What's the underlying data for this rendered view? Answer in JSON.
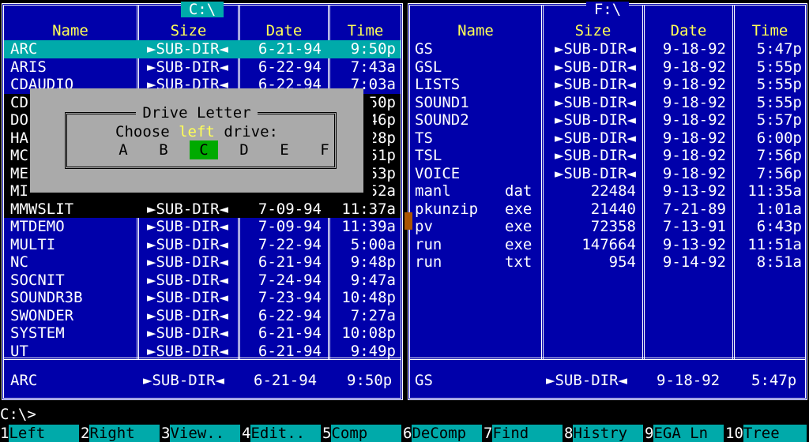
{
  "left_panel": {
    "title": "C:\\",
    "headers": [
      "Name",
      "Size",
      "Date",
      "Time"
    ],
    "rows": [
      {
        "name": "ARC",
        "ext": "",
        "size": "►SUB-DIR◄",
        "date": "6-21-94",
        "time": "9:50p"
      },
      {
        "name": "ARIS",
        "ext": "",
        "size": "►SUB-DIR◄",
        "date": "6-22-94",
        "time": "7:43a"
      },
      {
        "name": "CDAUDIO",
        "ext": "",
        "size": "►SUB-DIR◄",
        "date": "6-22-94",
        "time": "7:03a"
      },
      {
        "name": "CD",
        "ext": "",
        "size": "",
        "date": "",
        "time": "50p"
      },
      {
        "name": "DO",
        "ext": "",
        "size": "",
        "date": "",
        "time": "46p"
      },
      {
        "name": "HA",
        "ext": "",
        "size": "",
        "date": "",
        "time": "28p"
      },
      {
        "name": "MC",
        "ext": "",
        "size": "",
        "date": "",
        "time": "51p"
      },
      {
        "name": "ME",
        "ext": "",
        "size": "",
        "date": "",
        "time": "53p"
      },
      {
        "name": "MI",
        "ext": "",
        "size": "",
        "date": "",
        "time": "52a"
      },
      {
        "name": "MMWSLIT",
        "ext": "",
        "size": "►SUB-DIR◄",
        "date": "7-09-94",
        "time": "11:37a"
      },
      {
        "name": "MTDEMO",
        "ext": "",
        "size": "►SUB-DIR◄",
        "date": "7-09-94",
        "time": "11:39a"
      },
      {
        "name": "MULTI",
        "ext": "",
        "size": "►SUB-DIR◄",
        "date": "7-22-94",
        "time": "5:00a"
      },
      {
        "name": "NC",
        "ext": "",
        "size": "►SUB-DIR◄",
        "date": "6-21-94",
        "time": "9:48p"
      },
      {
        "name": "SOCNIT",
        "ext": "",
        "size": "►SUB-DIR◄",
        "date": "7-24-94",
        "time": "9:47a"
      },
      {
        "name": "SOUNDR3B",
        "ext": "",
        "size": "►SUB-DIR◄",
        "date": "7-23-94",
        "time": "10:48p"
      },
      {
        "name": "SWONDER",
        "ext": "",
        "size": "►SUB-DIR◄",
        "date": "6-22-94",
        "time": "7:27a"
      },
      {
        "name": "SYSTEM",
        "ext": "",
        "size": "►SUB-DIR◄",
        "date": "6-21-94",
        "time": "10:08p"
      },
      {
        "name": "UT",
        "ext": "",
        "size": "►SUB-DIR◄",
        "date": "6-21-94",
        "time": "9:49p"
      }
    ],
    "status": {
      "name": "ARC",
      "size": "►SUB-DIR◄",
      "date": "6-21-94",
      "time": "9:50p"
    }
  },
  "right_panel": {
    "title": "F:\\",
    "headers": [
      "Name",
      "Size",
      "Date",
      "Time"
    ],
    "rows": [
      {
        "name": "GS",
        "ext": "",
        "size": "►SUB-DIR◄",
        "date": "9-18-92",
        "time": "5:47p"
      },
      {
        "name": "GSL",
        "ext": "",
        "size": "►SUB-DIR◄",
        "date": "9-18-92",
        "time": "5:55p"
      },
      {
        "name": "LISTS",
        "ext": "",
        "size": "►SUB-DIR◄",
        "date": "9-18-92",
        "time": "5:55p"
      },
      {
        "name": "SOUND1",
        "ext": "",
        "size": "►SUB-DIR◄",
        "date": "9-18-92",
        "time": "5:55p"
      },
      {
        "name": "SOUND2",
        "ext": "",
        "size": "►SUB-DIR◄",
        "date": "9-18-92",
        "time": "5:57p"
      },
      {
        "name": "TS",
        "ext": "",
        "size": "►SUB-DIR◄",
        "date": "9-18-92",
        "time": "6:00p"
      },
      {
        "name": "TSL",
        "ext": "",
        "size": "►SUB-DIR◄",
        "date": "9-18-92",
        "time": "7:56p"
      },
      {
        "name": "VOICE",
        "ext": "",
        "size": "►SUB-DIR◄",
        "date": "9-18-92",
        "time": "7:56p"
      },
      {
        "name": "manl",
        "ext": "dat",
        "size": "22484",
        "date": "9-13-92",
        "time": "11:35a"
      },
      {
        "name": "pkunzip",
        "ext": "exe",
        "size": "21440",
        "date": "7-21-89",
        "time": "1:01a"
      },
      {
        "name": "pv",
        "ext": "exe",
        "size": "72358",
        "date": "7-13-91",
        "time": "6:43p"
      },
      {
        "name": "run",
        "ext": "exe",
        "size": "147664",
        "date": "9-13-92",
        "time": "11:51a"
      },
      {
        "name": "run",
        "ext": "txt",
        "size": "954",
        "date": "9-14-92",
        "time": "8:51a"
      }
    ],
    "status": {
      "name": "GS",
      "size": "►SUB-DIR◄",
      "date": "9-18-92",
      "time": "5:47p"
    }
  },
  "dialog": {
    "title": "Drive Letter",
    "prompt_before": "Choose ",
    "prompt_highlight": "left",
    "prompt_after": " drive:",
    "drives": [
      "A",
      "B",
      "C",
      "D",
      "E",
      "F"
    ],
    "selected_drive": "C"
  },
  "command_prompt": "C:\\>",
  "function_keys": [
    {
      "num": "1",
      "label": "Left"
    },
    {
      "num": "2",
      "label": "Right"
    },
    {
      "num": "3",
      "label": "View.."
    },
    {
      "num": "4",
      "label": "Edit.."
    },
    {
      "num": "5",
      "label": "Comp"
    },
    {
      "num": "6",
      "label": "DeComp"
    },
    {
      "num": "7",
      "label": "Find"
    },
    {
      "num": "8",
      "label": "Histry"
    },
    {
      "num": "9",
      "label": "EGA Ln"
    },
    {
      "num": "10",
      "label": "Tree"
    }
  ],
  "colors": {
    "panel_bg": "#0000aa",
    "header_text": "#ffff55",
    "selection_bg": "#00aaaa",
    "dialog_bg": "#aaaaaa",
    "drive_selected_bg": "#00aa00"
  }
}
